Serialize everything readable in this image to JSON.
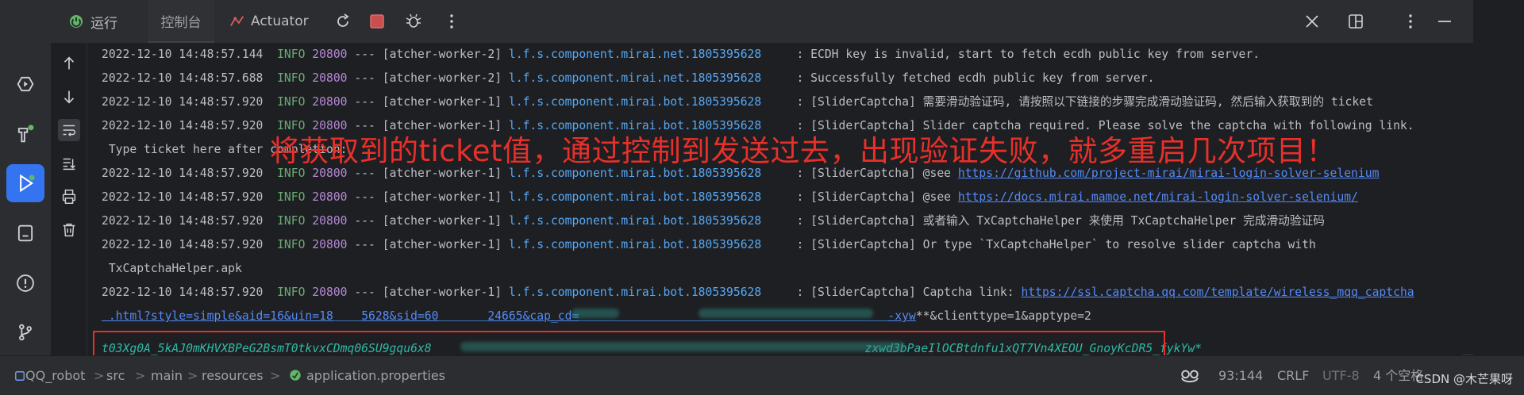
{
  "tabs": {
    "run_label": "运行",
    "console_label": "控制台",
    "actuator_label": "Actuator"
  },
  "console": {
    "lines": [
      {
        "ts": "2022-12-10 14:48:57.144",
        "level": "INFO",
        "pid": "20800",
        "sep": "---",
        "thread": "[atcher-worker-2]",
        "logger": "l.f.s.component.mirai.net.1805395628",
        "msg": ": ECDH key is invalid, start to fetch ecdh public key from server."
      },
      {
        "ts": "2022-12-10 14:48:57.688",
        "level": "INFO",
        "pid": "20800",
        "sep": "---",
        "thread": "[atcher-worker-2]",
        "logger": "l.f.s.component.mirai.net.1805395628",
        "msg": ": Successfully fetched ecdh public key from server."
      },
      {
        "ts": "2022-12-10 14:48:57.920",
        "level": "INFO",
        "pid": "20800",
        "sep": "---",
        "thread": "[atcher-worker-1]",
        "logger": "l.f.s.component.mirai.bot.1805395628",
        "msg": ": [SliderCaptcha] 需要滑动验证码, 请按照以下链接的步骤完成滑动验证码, 然后输入获取到的 ticket"
      },
      {
        "ts": "2022-12-10 14:48:57.920",
        "level": "INFO",
        "pid": "20800",
        "sep": "---",
        "thread": "[atcher-worker-1]",
        "logger": "l.f.s.component.mirai.bot.1805395628",
        "msg": ": [SliderCaptcha] Slider captcha required. Please solve the captcha with following link."
      },
      {
        "ts": "2022-12-10 14:48:57.920",
        "level": "INFO",
        "pid": "20800",
        "sep": "---",
        "thread": "[atcher-worker-1]",
        "logger": "l.f.s.component.mirai.bot.1805395628",
        "msg": ": [SliderCaptcha] @see ",
        "link": "https://github.com/project-mirai/mirai-login-solver-selenium"
      },
      {
        "ts": "2022-12-10 14:48:57.920",
        "level": "INFO",
        "pid": "20800",
        "sep": "---",
        "thread": "[atcher-worker-1]",
        "logger": "l.f.s.component.mirai.bot.1805395628",
        "msg": ": [SliderCaptcha] @see ",
        "link": "https://docs.mirai.mamoe.net/mirai-login-solver-selenium/"
      },
      {
        "ts": "2022-12-10 14:48:57.920",
        "level": "INFO",
        "pid": "20800",
        "sep": "---",
        "thread": "[atcher-worker-1]",
        "logger": "l.f.s.component.mirai.bot.1805395628",
        "msg": ": [SliderCaptcha] 或者输入 TxCaptchaHelper 来使用 TxCaptchaHelper 完成滑动验证码"
      },
      {
        "ts": "2022-12-10 14:48:57.920",
        "level": "INFO",
        "pid": "20800",
        "sep": "---",
        "thread": "[atcher-worker-1]",
        "logger": "l.f.s.component.mirai.bot.1805395628",
        "msg": ": [SliderCaptcha] Or type `TxCaptchaHelper` to resolve slider captcha with"
      },
      {
        "ts": "2022-12-10 14:48:57.920",
        "level": "INFO",
        "pid": "20800",
        "sep": "---",
        "thread": "[atcher-worker-1]",
        "logger": "l.f.s.component.mirai.bot.1805395628",
        "msg": ": [SliderCaptcha] Captcha link: ",
        "link": "https://ssl.captcha.qq.com/template/wireless_mqq_captcha"
      }
    ],
    "wrap_ticket": " Type ticket here after completion:",
    "wrap_helper": " TxCaptchaHelper.apk",
    "wrap_link_start": " .html?style=simple&aid=16&uin=18",
    "wrap_link_mid1": "5628&sid=60",
    "wrap_link_mid2": "24665&cap_cd=",
    "wrap_link_end": "-xyw",
    "wrap_link_suffix": "**&clienttype=1&apptype=2",
    "input_start": "t03Xg0A_5kAJ0mKHVXBPeG2BsmT0tkvxCDmq06SU9gqu6x8",
    "input_end": "zxwd3bPaeIlOCBtdnfu1xQT7Vn4XEOU_GnoyKcDR5_fykYw*"
  },
  "annotation": {
    "text": "将获取到的ticket值，通过控制到发送过去，出现验证失败，就多重启几次项目！"
  },
  "statusbar": {
    "project": "QQ_robot",
    "path": [
      "src",
      "main",
      "resources"
    ],
    "file": "application.properties",
    "position": "93:144",
    "line_ending": "CRLF",
    "encoding": "UTF-8",
    "indent": "4 个空格",
    "watermark": "CSDN @木芒果呀"
  },
  "colors": {
    "accent": "#3574f0",
    "annotation_red": "#e8302a",
    "info_green": "#6aab73",
    "link_blue": "#548af7"
  }
}
